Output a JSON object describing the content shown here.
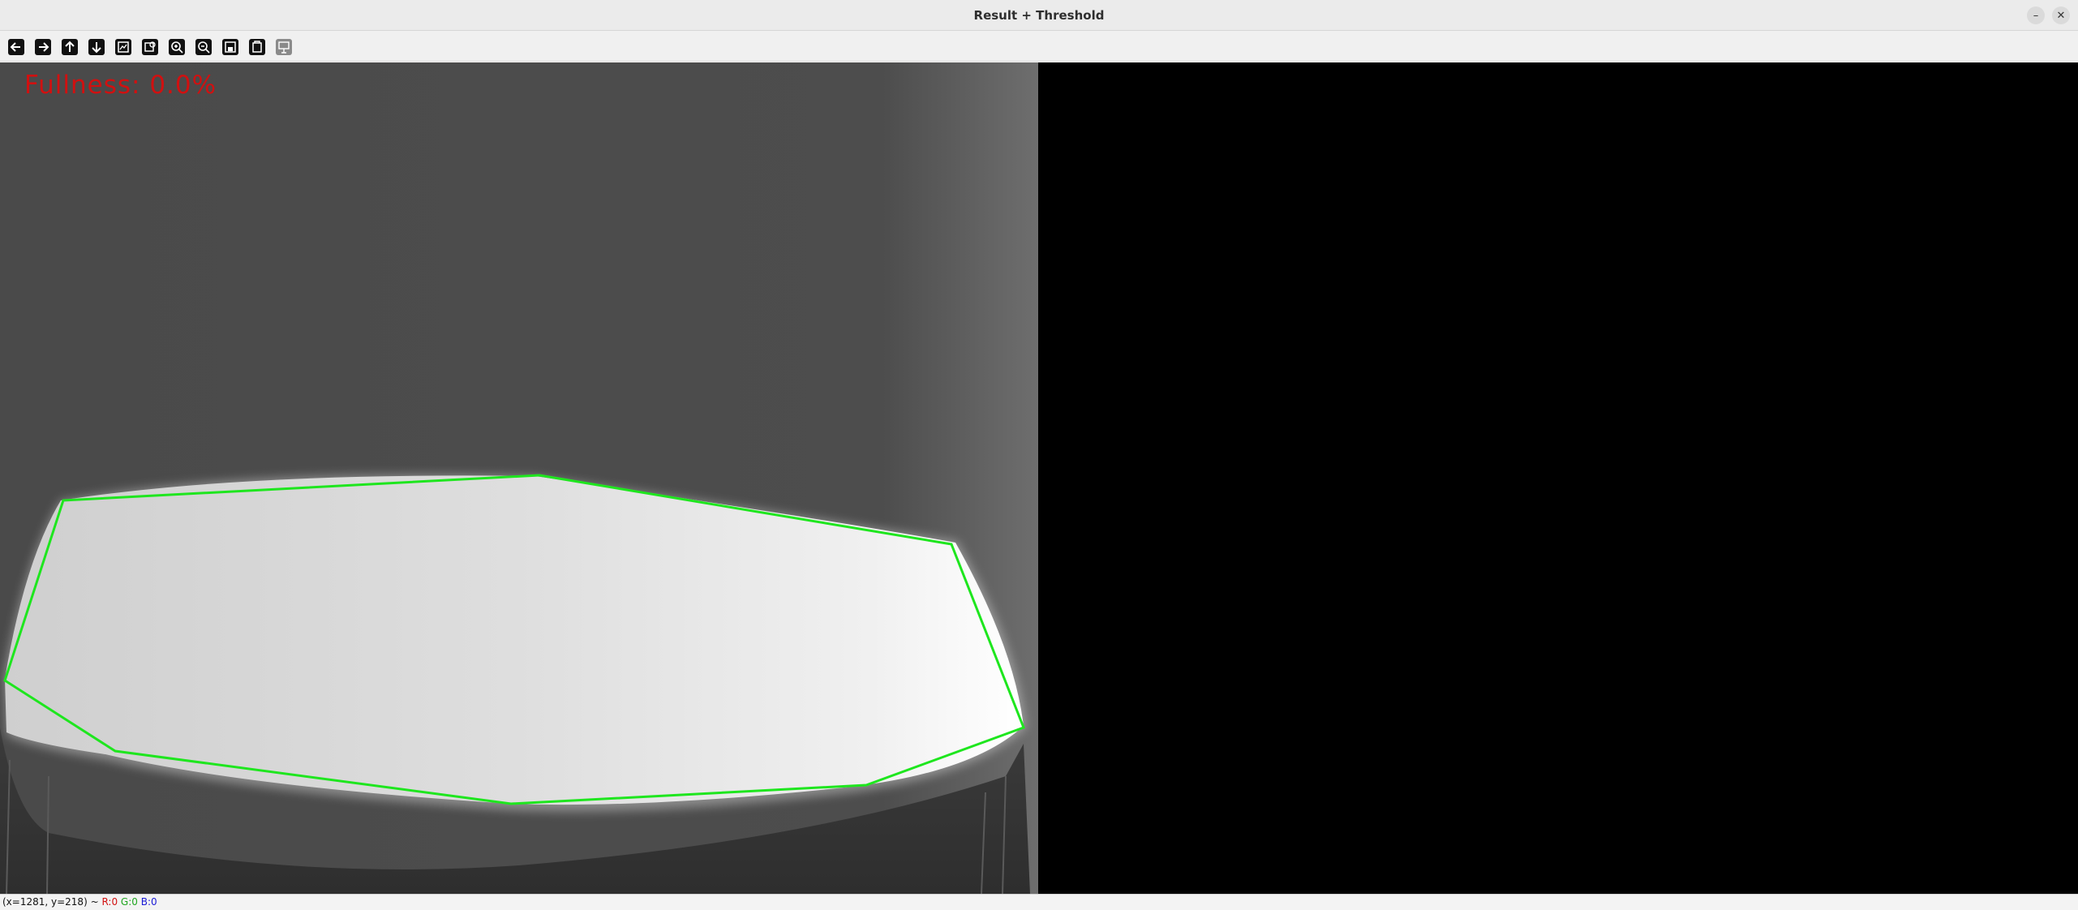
{
  "window": {
    "title": "Result + Threshold",
    "minimize_icon": "minimize-icon",
    "close_icon": "close-icon"
  },
  "toolbar": {
    "buttons": [
      {
        "icon": "arrow-left-icon",
        "name": "pan-left-button"
      },
      {
        "icon": "arrow-right-icon",
        "name": "pan-right-button"
      },
      {
        "icon": "arrow-up-icon",
        "name": "pan-up-button"
      },
      {
        "icon": "arrow-down-icon",
        "name": "pan-down-button"
      },
      {
        "icon": "zoom-original-icon",
        "name": "zoom-original-button"
      },
      {
        "icon": "zoom-fit-icon",
        "name": "zoom-fit-button"
      },
      {
        "icon": "zoom-in-icon",
        "name": "zoom-in-button"
      },
      {
        "icon": "zoom-out-icon",
        "name": "zoom-out-button"
      },
      {
        "icon": "save-icon",
        "name": "save-button"
      },
      {
        "icon": "copy-icon",
        "name": "copy-button"
      },
      {
        "icon": "properties-icon",
        "name": "properties-button"
      }
    ]
  },
  "image": {
    "overlay_text": "Fullness: 0.0%",
    "overlay_color": "#d11010",
    "contour_color": "#1ee61e",
    "threshold_color": "#000000"
  },
  "status": {
    "coords": "(x=1281, y=218) ~ ",
    "r": "R:0",
    "g": "G:0",
    "b": "B:0"
  }
}
